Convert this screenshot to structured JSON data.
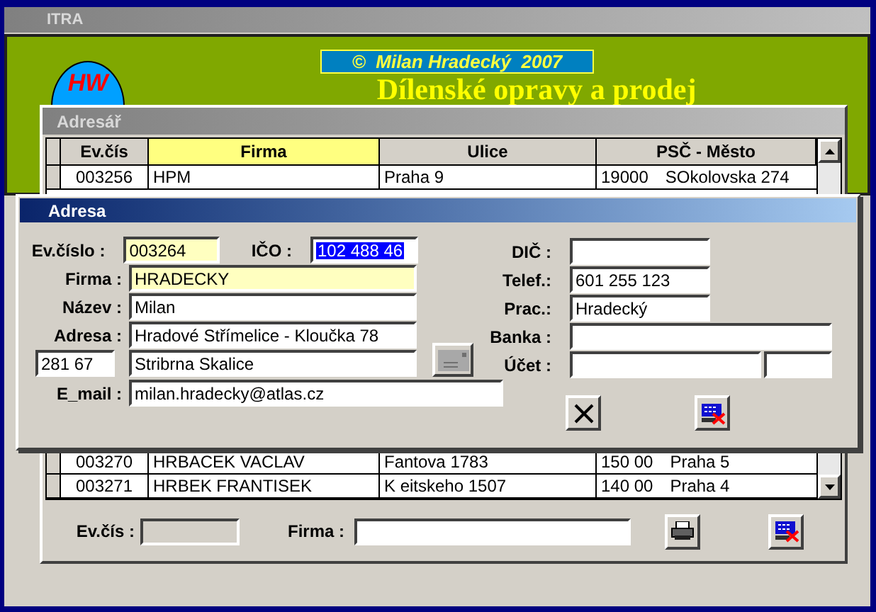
{
  "app": {
    "title": "ITRA",
    "copyright": "©  Milan Hradecký  2007",
    "logo_text": "HW",
    "headline": "Dílenské opravy a prodej"
  },
  "address_book": {
    "title": "Adresář",
    "columns": [
      {
        "label": "Ev.čís",
        "selected": false
      },
      {
        "label": "Firma",
        "selected": true
      },
      {
        "label": "Ulice",
        "selected": false
      },
      {
        "label": "PSČ - Město",
        "selected": false
      }
    ],
    "rows_top": [
      {
        "ev": "003256",
        "firma": "HPM",
        "ulice": "Praha 9",
        "psc": "19000",
        "mesto": "SOkolovska 274"
      }
    ],
    "rows_bottom": [
      {
        "ev": "003270",
        "firma": "HRBACEK VACLAV",
        "ulice": "Fantova 1783",
        "psc": "150 00",
        "mesto": "Praha 5"
      },
      {
        "ev": "003271",
        "firma": "HRBEK FRANTISEK",
        "ulice": "K  eitskeho 1507",
        "psc": "140 00",
        "mesto": "Praha 4"
      }
    ],
    "filter": {
      "ev_label": "Ev.čís :",
      "firma_label": "Firma :"
    }
  },
  "dialog": {
    "title": "Adresa",
    "ev": {
      "label": "Ev.číslo :",
      "value": "003264",
      "highlighted": true
    },
    "ico": {
      "label": "IČO :",
      "value": "102 488 46",
      "selected": true
    },
    "firma": {
      "label": "Firma :",
      "value": "HRADECKY",
      "highlighted": true
    },
    "nazev": {
      "label": "Název :",
      "value": "Milan",
      "highlighted": false
    },
    "adresa": {
      "label": "Adresa :",
      "value": "Hradové Střímelice - Kloučka 78",
      "highlighted": false
    },
    "psc": {
      "value": "281 67"
    },
    "mesto": {
      "value": "Stribrna Skalice",
      "highlighted": false
    },
    "email": {
      "label": "E_mail :",
      "value": "milan.hradecky@atlas.cz"
    },
    "dic": {
      "label": "DIČ :"
    },
    "telef": {
      "label": "Telef.:",
      "value": "601 255 123"
    },
    "prac": {
      "label": "Prac.:",
      "value": "Hradecký"
    },
    "banka": {
      "label": "Banka :"
    },
    "ucet": {
      "label": "Účet :"
    }
  }
}
